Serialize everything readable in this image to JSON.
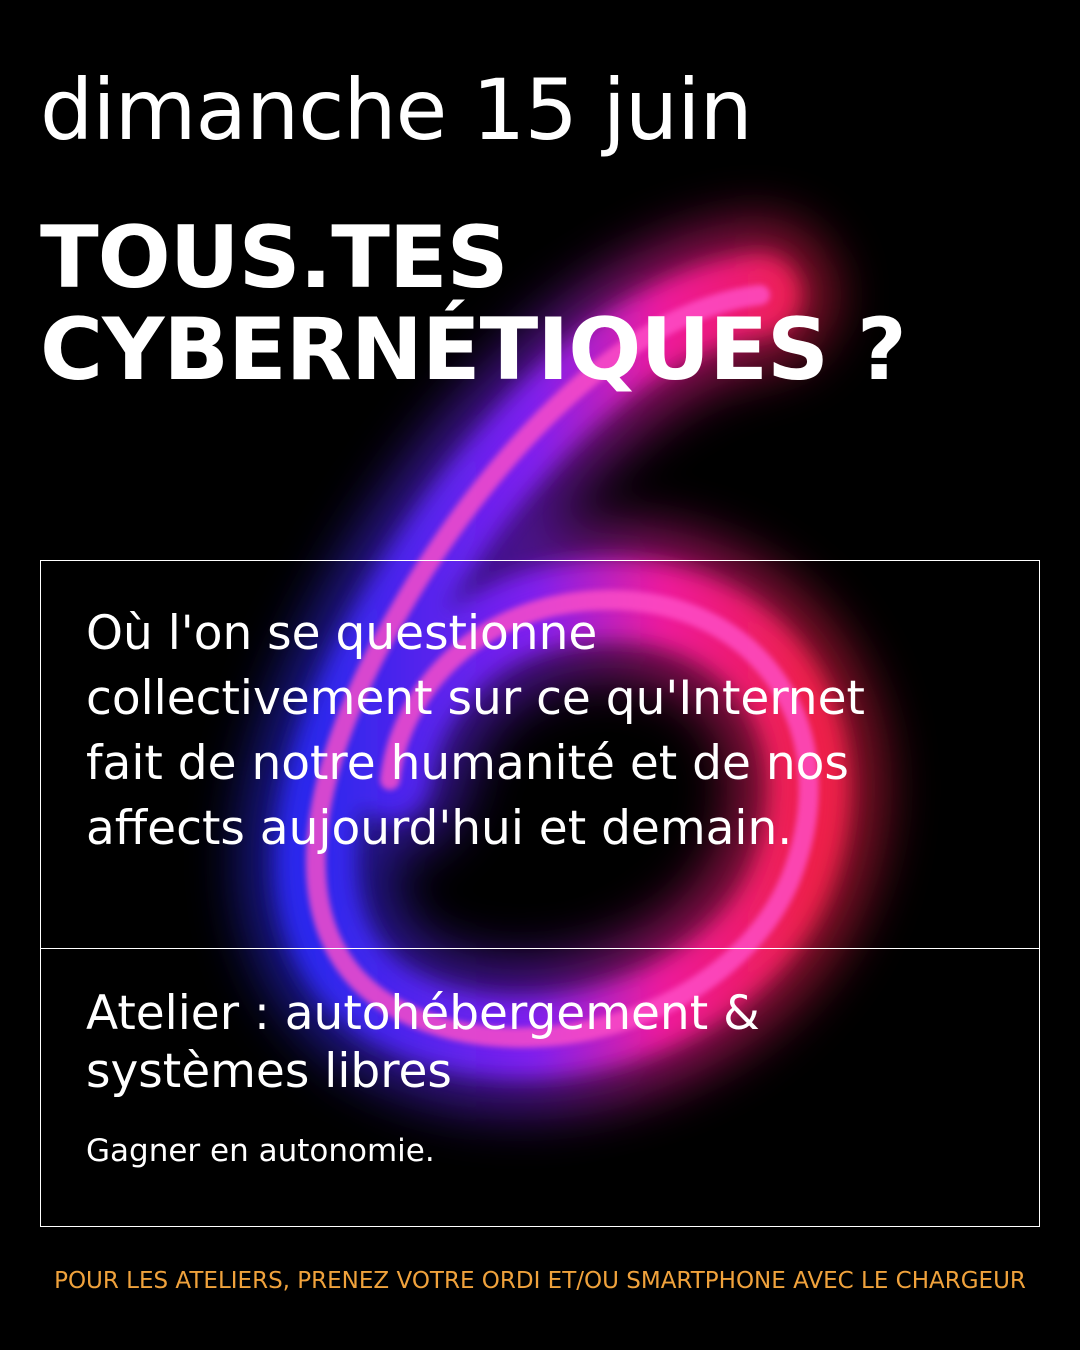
{
  "date": "dimanche 15 juin",
  "title": {
    "line1": "TOUS.TES",
    "line2": "CYBERNÉTIQUES ?"
  },
  "description": {
    "line1": "Où l'on se questionne",
    "line2": "collectivement sur ce qu'Internet",
    "line3": "fait de notre humanité et de nos",
    "line4": "affects aujourd'hui et demain."
  },
  "workshop": {
    "title_line1": "Atelier : autohébergement &",
    "title_line2": "systèmes libres",
    "subtitle": "Gagner en autonomie."
  },
  "footer": "POUR LES ATELIERS, PRENEZ VOTRE ORDI ET/OU SMARTPHONE AVEC LE CHARGEUR",
  "colors": {
    "background": "#000000",
    "text": "#ffffff",
    "footer": "#f0a23c",
    "glow_blue": "#3a2cff",
    "glow_magenta": "#ff1fa8",
    "glow_red": "#ff2050"
  },
  "icons": {
    "glow_shape": "glowing-six-shape"
  }
}
